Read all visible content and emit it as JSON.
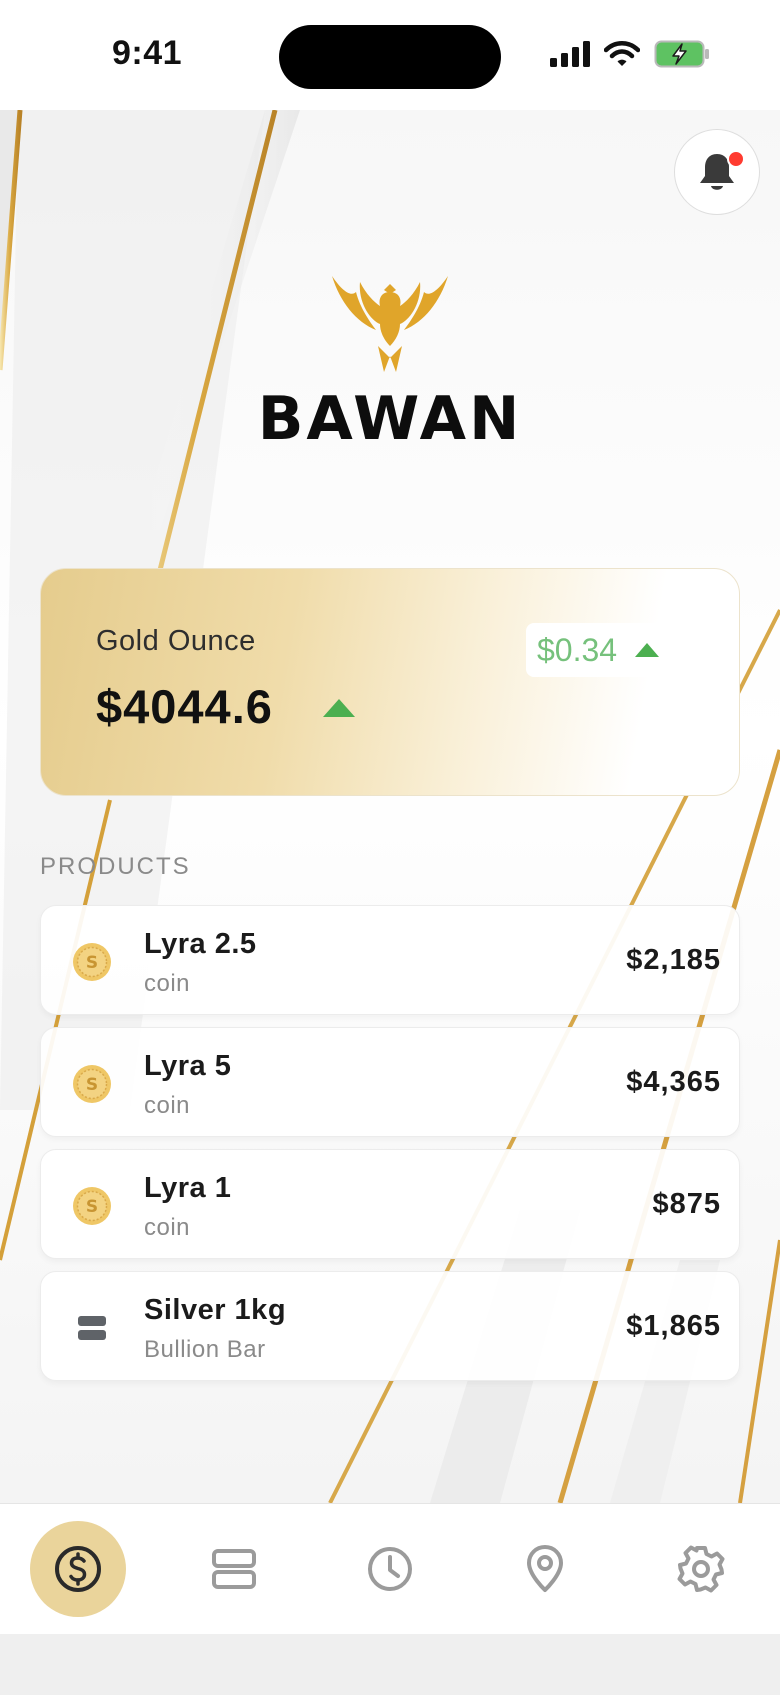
{
  "status_bar": {
    "time": "9:41",
    "icons": [
      "cellular-signal-icon",
      "wifi-icon",
      "battery-charging-icon"
    ]
  },
  "header": {
    "notification_icon": "bell-icon",
    "has_unread": true
  },
  "brand": {
    "name": "BAWAN",
    "logo_icon": "eagle-icon",
    "logo_color": "#e0a52a"
  },
  "gold_card": {
    "label": "Gold Ounce",
    "price": "$4044.6",
    "change": "$0.34",
    "trend": "up",
    "trend_color": "#4caf50"
  },
  "products": {
    "title": "PRODUCTS",
    "items": [
      {
        "name": "Lyra 2.5",
        "type": "coin",
        "price": "$2,185",
        "icon": "coin-icon"
      },
      {
        "name": "Lyra 5",
        "type": "coin",
        "price": "$4,365",
        "icon": "coin-icon"
      },
      {
        "name": "Lyra 1",
        "type": "coin",
        "price": "$875",
        "icon": "coin-icon"
      },
      {
        "name": "Silver 1kg",
        "type": "Bullion Bar",
        "price": "$1,865",
        "icon": "bullion-bar-icon"
      }
    ]
  },
  "bottom_nav": {
    "active": "prices",
    "items": [
      {
        "id": "prices",
        "icon": "dollar-icon"
      },
      {
        "id": "products",
        "icon": "stack-icon"
      },
      {
        "id": "history",
        "icon": "clock-icon"
      },
      {
        "id": "locations",
        "icon": "location-pin-icon"
      },
      {
        "id": "settings",
        "icon": "gear-icon"
      }
    ]
  },
  "colors": {
    "accent_gold": "#ead49b",
    "up_green": "#4caf50",
    "change_text": "#76c17c",
    "notification_red": "#ff3b30"
  }
}
